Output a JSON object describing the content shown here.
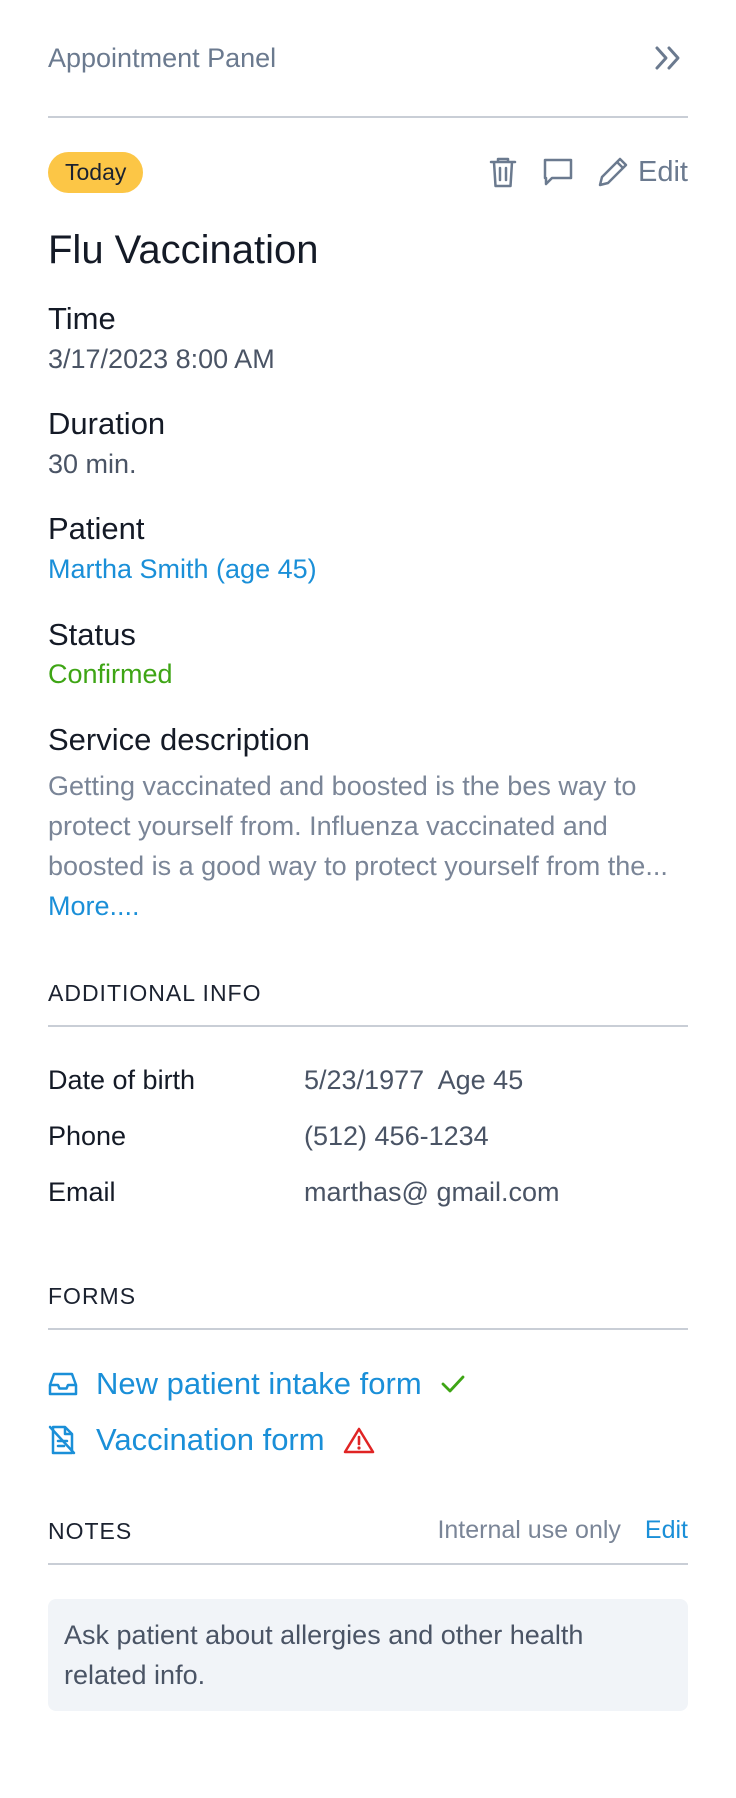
{
  "header": {
    "title": "Appointment Panel"
  },
  "toolbar": {
    "badge": "Today",
    "edit_label": "Edit"
  },
  "appointment": {
    "title": "Flu Vaccination",
    "time": {
      "label": "Time",
      "value": "3/17/2023 8:00 AM"
    },
    "duration": {
      "label": "Duration",
      "value": "30 min."
    },
    "patient": {
      "label": "Patient",
      "value": "Martha Smith (age 45)"
    },
    "status": {
      "label": "Status",
      "value": "Confirmed",
      "color": "#3ea515"
    },
    "service": {
      "label": "Service description",
      "lines": [
        "Getting vaccinated and boosted is the bes way to",
        "protect yourself from. Influenza vaccinated and",
        "boosted is a good way to protect yourself from the..."
      ],
      "more_label": "More...."
    }
  },
  "additional_info": {
    "title": "ADDITIONAL INFO",
    "rows": [
      {
        "key": "Date of birth",
        "value": "5/23/1977  Age 45"
      },
      {
        "key": "Phone",
        "value": "(512) 456-1234"
      },
      {
        "key": "Email",
        "value": "marthas@ gmail.com"
      }
    ]
  },
  "forms": {
    "title": "FORMS",
    "items": [
      {
        "label": "New patient intake form",
        "lead_icon": "inbox-icon",
        "status_icon": "check-icon"
      },
      {
        "label": "Vaccination form",
        "lead_icon": "document-off-icon",
        "status_icon": "warning-icon"
      }
    ]
  },
  "notes": {
    "title": "NOTES",
    "hint": "Internal use only",
    "edit_label": "Edit",
    "text": "Ask patient about allergies and other health related info."
  },
  "colors": {
    "accent": "#1a8fd8",
    "badge": "#fcc646",
    "success": "#3ea515",
    "danger": "#e02424",
    "muted": "#6b7a8f"
  }
}
